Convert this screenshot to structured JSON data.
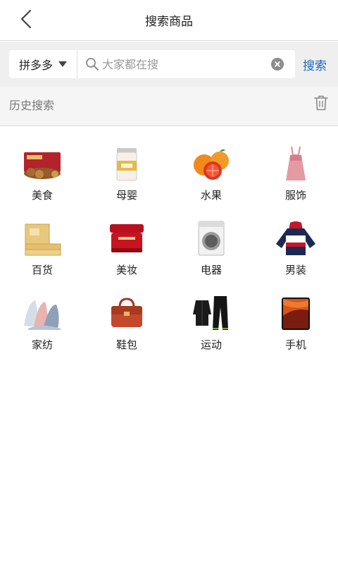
{
  "header": {
    "title": "搜索商品",
    "back_icon": "chevron-left-icon"
  },
  "search": {
    "platform": "拼多多",
    "placeholder": "大家都在搜",
    "value": "",
    "button_label": "搜索",
    "accent_color": "#1e6ab8"
  },
  "history": {
    "label": "历史搜索",
    "clear_icon": "trash-icon"
  },
  "categories": [
    {
      "label": "美食",
      "icon": "snack-gift-box-image"
    },
    {
      "label": "母婴",
      "icon": "milk-powder-can-image"
    },
    {
      "label": "水果",
      "icon": "blood-orange-image"
    },
    {
      "label": "服饰",
      "icon": "pink-dress-image"
    },
    {
      "label": "百货",
      "icon": "tissue-boxes-image"
    },
    {
      "label": "美妆",
      "icon": "cream-jar-image"
    },
    {
      "label": "电器",
      "icon": "washing-machine-image"
    },
    {
      "label": "男装",
      "icon": "hoodie-image"
    },
    {
      "label": "家纺",
      "icon": "blankets-image"
    },
    {
      "label": "鞋包",
      "icon": "handbag-image"
    },
    {
      "label": "运动",
      "icon": "tracksuit-image"
    },
    {
      "label": "手机",
      "icon": "smartphone-image"
    }
  ]
}
